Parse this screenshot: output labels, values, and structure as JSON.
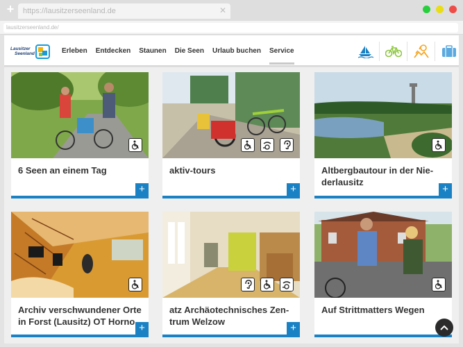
{
  "browser": {
    "tab_url": "https://lausitzerseenland.de",
    "address": "lausitzerseenland.de/"
  },
  "logo": {
    "line1": "Lausitzer",
    "line2": "Seenland"
  },
  "nav": {
    "items": [
      "Erleben",
      "Entdecken",
      "Staunen",
      "Die Seen",
      "Urlaub buchen",
      "Service"
    ],
    "icons": [
      "sailboat-icon",
      "bicycle-icon",
      "hiking-icon",
      "suitcase-icon"
    ]
  },
  "cards": [
    {
      "title": "6 Seen an einem Tag",
      "badges": [
        "wheelchair-icon"
      ]
    },
    {
      "title": "aktiv-tours",
      "badges": [
        "wheelchair-icon",
        "wheelchair-assist-icon",
        "hearing-icon"
      ]
    },
    {
      "title": "Altbergbautour in der Nie-derlausitz",
      "badges": [
        "wheelchair-icon"
      ]
    },
    {
      "title": "Archiv verschwundener Orte in Forst (Lausitz) OT Horno",
      "badges": [
        "wheelchair-icon"
      ]
    },
    {
      "title": "atz Archäotechnisches Zen-trum Welzow",
      "badges": [
        "hearing-icon",
        "wheelchair-icon",
        "wheelchair-assist-icon"
      ]
    },
    {
      "title": "Auf Strittmatters Wegen",
      "badges": [
        "wheelchair-icon"
      ]
    }
  ],
  "plus_label": "+",
  "accent_color": "#1a82c4"
}
